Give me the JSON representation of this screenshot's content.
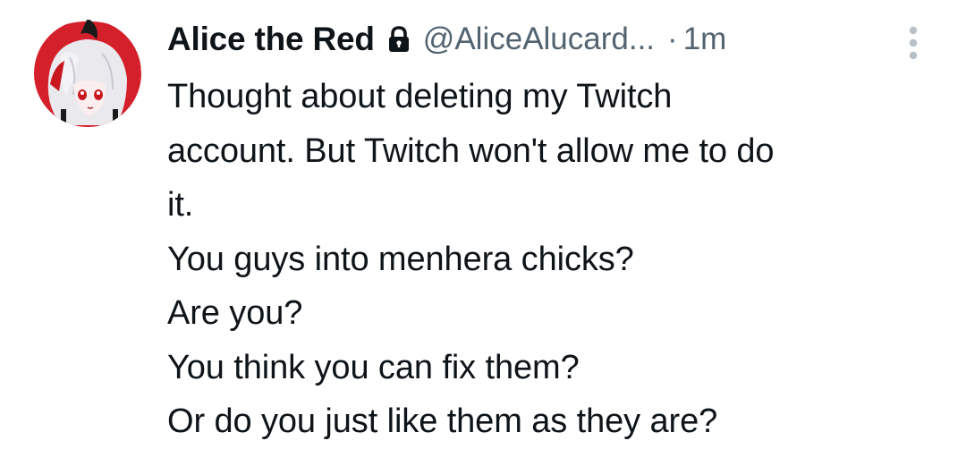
{
  "tweet": {
    "author": {
      "display_name": "Alice the Red",
      "handle": "@AliceAlucard...",
      "protected_icon": "lock-icon"
    },
    "separator": "·",
    "timestamp": "1m",
    "more_icon": "more-vertical-icon",
    "text_lines": [
      "Thought about deleting my Twitch",
      "account. But Twitch won't allow me to do",
      "it.",
      "You guys into menhera chicks?",
      "Are you?",
      "You think you can fix them?",
      "Or do you just like them as they are?"
    ]
  },
  "colors": {
    "primary_text": "#0f1419",
    "secondary_text": "#536471",
    "avatar_red": "#d4202a",
    "more_icon": "#b8c0c8"
  }
}
